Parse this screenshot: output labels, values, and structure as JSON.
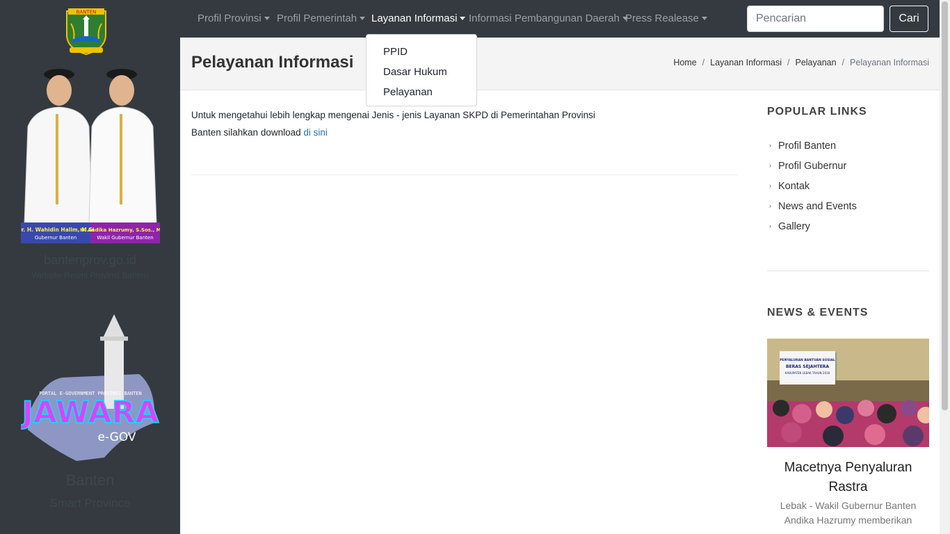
{
  "sidebar": {
    "logo_text": "BANTEN",
    "officials": [
      {
        "name": "Dr. H. Wahidin Halim, M.Si",
        "role": "Gubernur Banten"
      },
      {
        "name": "H. Andika Hazrumy, S.Sos., M.AP",
        "role": "Wakil Gubernur Banten"
      }
    ],
    "site_domain": "bantenprov.go.id",
    "site_tagline": "Website Resmi Provinsi Banten",
    "portal_caption": "PORTAL E-GOVERNMENT PROVINSI BANTEN",
    "portal_name": "JAWARA",
    "portal_sub": "e-GOV",
    "region_name": "Banten",
    "region_tagline": "Smart Province"
  },
  "nav": {
    "items": [
      {
        "label": "Profil Provinsi"
      },
      {
        "label": "Profil Pemerintah"
      },
      {
        "label": "Layanan Informasi"
      },
      {
        "label": "Informasi Pembangunan Daerah"
      },
      {
        "label": "Press Realease"
      }
    ],
    "active_index": 2,
    "dropdown": [
      "PPID",
      "Dasar Hukum",
      "Pelayanan"
    ],
    "search_placeholder": "Pencarian",
    "search_button": "Cari"
  },
  "page": {
    "title": "Pelayanan Informasi",
    "breadcrumb": [
      "Home",
      "Layanan Informasi",
      "Pelayanan",
      "Pelayanan Informasi"
    ],
    "body_text": "Untuk mengetahui lebih lengkap mengenai Jenis - jenis Layanan SKPD di Pemerintahan Provinsi Banten silahkan download",
    "body_link": "di sini"
  },
  "right": {
    "popular_heading": "POPULAR LINKS",
    "popular_links": [
      "Profil Banten",
      "Profil Gubernur",
      "Kontak",
      "News and Events",
      "Gallery"
    ],
    "news_heading": "NEWS & EVENTS",
    "news_title": "Macetnya Penyaluran Rastra",
    "news_excerpt": "Lebak - Wakil Gubernur Banten Andika Hazrumy memberikan",
    "banner_lines": [
      "PENYALURAN BANTUAN SOSIAL",
      "BERAS SEJAHTERA",
      "KABUPATEN LEBAK TAHUN 2018"
    ]
  },
  "colors": {
    "sidebar_bg": "#343a40",
    "nav_bg": "#343a40",
    "link": "#1b75bb"
  }
}
